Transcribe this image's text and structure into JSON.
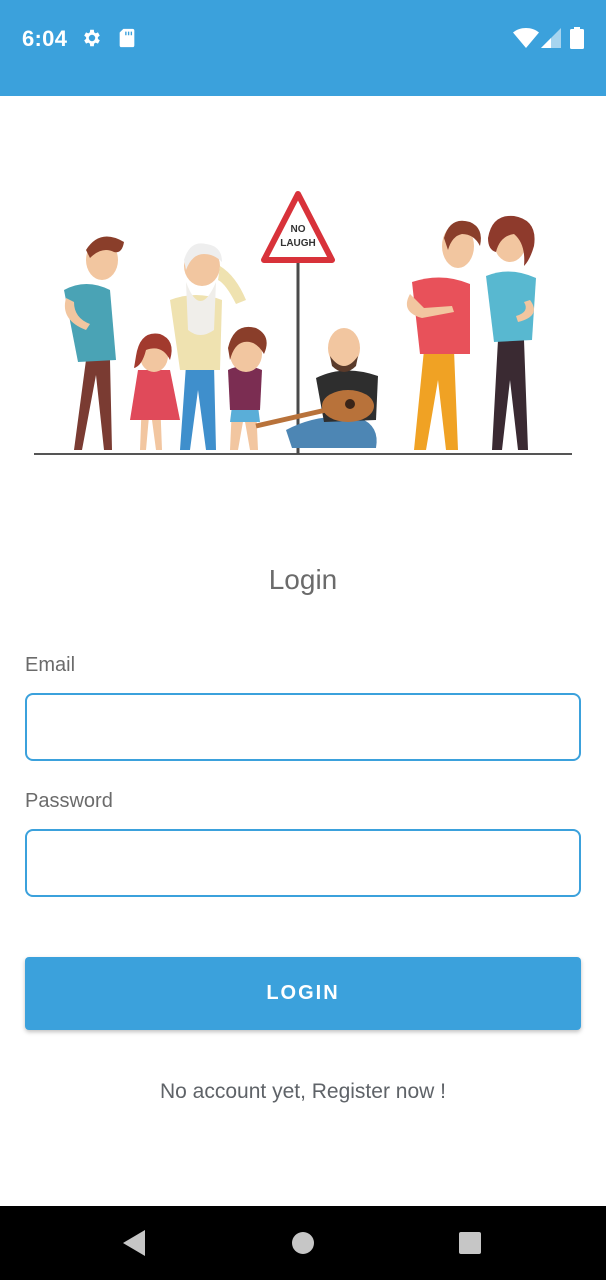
{
  "status_bar": {
    "time": "6:04",
    "background": "#3ba1dc",
    "left_icons": [
      "gear-icon",
      "sd-card-icon"
    ],
    "right_icons": [
      "wifi-icon",
      "cell-signal-icon",
      "battery-icon"
    ]
  },
  "illustration": {
    "sign_text_line1": "NO",
    "sign_text_line2": "LAUGH"
  },
  "login": {
    "title": "Login",
    "email_label": "Email",
    "email_value": "",
    "password_label": "Password",
    "password_value": "",
    "button_label": "LOGIN",
    "register_text": "No account yet, Register now !"
  },
  "nav_bar": {
    "icons": [
      "back-icon",
      "home-icon",
      "recents-icon"
    ]
  },
  "colors": {
    "accent": "#3ba1dc",
    "text": "#6b6b6b"
  }
}
